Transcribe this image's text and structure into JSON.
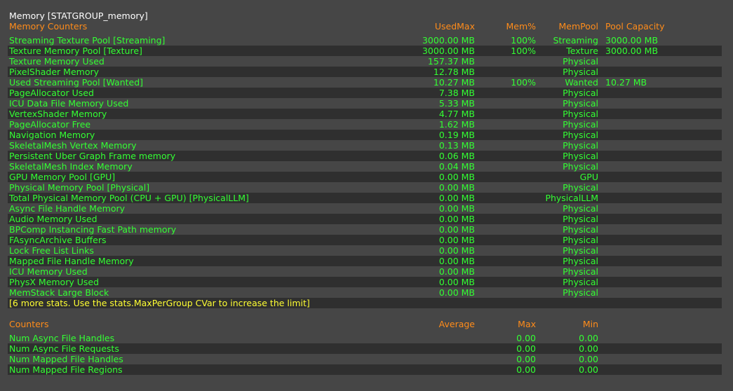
{
  "title": "Memory [STATGROUP_memory]",
  "memory_table": {
    "headers": {
      "name": "Memory Counters",
      "used_max": "UsedMax",
      "mem_pct": "Mem%",
      "mem_pool": "MemPool",
      "pool_capacity": "Pool Capacity"
    },
    "rows": [
      {
        "name": "Streaming Texture Pool [Streaming]",
        "used_max": "3000.00 MB",
        "mem_pct": "100%",
        "mem_pool": "Streaming",
        "pool_capacity": "3000.00 MB"
      },
      {
        "name": "Texture Memory Pool [Texture]",
        "used_max": "3000.00 MB",
        "mem_pct": "100%",
        "mem_pool": "Texture",
        "pool_capacity": "3000.00 MB"
      },
      {
        "name": "Texture Memory Used",
        "used_max": "157.37 MB",
        "mem_pct": "",
        "mem_pool": "Physical",
        "pool_capacity": ""
      },
      {
        "name": "PixelShader Memory",
        "used_max": "12.78 MB",
        "mem_pct": "",
        "mem_pool": "Physical",
        "pool_capacity": ""
      },
      {
        "name": "Used Streaming Pool [Wanted]",
        "used_max": "10.27 MB",
        "mem_pct": "100%",
        "mem_pool": "Wanted",
        "pool_capacity": "10.27 MB"
      },
      {
        "name": "PageAllocator Used",
        "used_max": "7.38 MB",
        "mem_pct": "",
        "mem_pool": "Physical",
        "pool_capacity": ""
      },
      {
        "name": "ICU Data File Memory Used",
        "used_max": "5.33 MB",
        "mem_pct": "",
        "mem_pool": "Physical",
        "pool_capacity": ""
      },
      {
        "name": "VertexShader Memory",
        "used_max": "4.77 MB",
        "mem_pct": "",
        "mem_pool": "Physical",
        "pool_capacity": ""
      },
      {
        "name": "PageAllocator Free",
        "used_max": "1.62 MB",
        "mem_pct": "",
        "mem_pool": "Physical",
        "pool_capacity": ""
      },
      {
        "name": "Navigation Memory",
        "used_max": "0.19 MB",
        "mem_pct": "",
        "mem_pool": "Physical",
        "pool_capacity": ""
      },
      {
        "name": "SkeletalMesh Vertex Memory",
        "used_max": "0.13 MB",
        "mem_pct": "",
        "mem_pool": "Physical",
        "pool_capacity": ""
      },
      {
        "name": "Persistent Uber Graph Frame memory",
        "used_max": "0.06 MB",
        "mem_pct": "",
        "mem_pool": "Physical",
        "pool_capacity": ""
      },
      {
        "name": "SkeletalMesh Index Memory",
        "used_max": "0.04 MB",
        "mem_pct": "",
        "mem_pool": "Physical",
        "pool_capacity": ""
      },
      {
        "name": "GPU Memory Pool [GPU]",
        "used_max": "0.00 MB",
        "mem_pct": "",
        "mem_pool": "GPU",
        "pool_capacity": ""
      },
      {
        "name": "Physical Memory Pool [Physical]",
        "used_max": "0.00 MB",
        "mem_pct": "",
        "mem_pool": "Physical",
        "pool_capacity": ""
      },
      {
        "name": "Total Physical Memory Pool (CPU + GPU) [PhysicalLLM]",
        "used_max": "0.00 MB",
        "mem_pct": "",
        "mem_pool": "PhysicalLLM",
        "pool_capacity": ""
      },
      {
        "name": "Async File Handle Memory",
        "used_max": "0.00 MB",
        "mem_pct": "",
        "mem_pool": "Physical",
        "pool_capacity": ""
      },
      {
        "name": "Audio Memory Used",
        "used_max": "0.00 MB",
        "mem_pct": "",
        "mem_pool": "Physical",
        "pool_capacity": ""
      },
      {
        "name": "BPComp Instancing Fast Path memory",
        "used_max": "0.00 MB",
        "mem_pct": "",
        "mem_pool": "Physical",
        "pool_capacity": ""
      },
      {
        "name": "FAsyncArchive Buffers",
        "used_max": "0.00 MB",
        "mem_pct": "",
        "mem_pool": "Physical",
        "pool_capacity": ""
      },
      {
        "name": "Lock Free List Links",
        "used_max": "0.00 MB",
        "mem_pct": "",
        "mem_pool": "Physical",
        "pool_capacity": ""
      },
      {
        "name": "Mapped File Handle Memory",
        "used_max": "0.00 MB",
        "mem_pct": "",
        "mem_pool": "Physical",
        "pool_capacity": ""
      },
      {
        "name": "ICU Memory Used",
        "used_max": "0.00 MB",
        "mem_pct": "",
        "mem_pool": "Physical",
        "pool_capacity": ""
      },
      {
        "name": "PhysX Memory Used",
        "used_max": "0.00 MB",
        "mem_pct": "",
        "mem_pool": "Physical",
        "pool_capacity": ""
      },
      {
        "name": "MemStack Large Block",
        "used_max": "0.00 MB",
        "mem_pct": "",
        "mem_pool": "Physical",
        "pool_capacity": ""
      }
    ],
    "note": "[6 more stats. Use the stats.MaxPerGroup CVar to increase the limit]"
  },
  "counters_table": {
    "headers": {
      "name": "Counters",
      "average": "Average",
      "max": "Max",
      "min": "Min"
    },
    "rows": [
      {
        "name": "Num Async File Handles",
        "average": "",
        "max": "0.00",
        "min": "0.00"
      },
      {
        "name": "Num Async File Requests",
        "average": "",
        "max": "0.00",
        "min": "0.00"
      },
      {
        "name": "Num Mapped File Handles",
        "average": "",
        "max": "0.00",
        "min": "0.00"
      },
      {
        "name": "Num Mapped File Regions",
        "average": "",
        "max": "0.00",
        "min": "0.00"
      }
    ]
  },
  "colors": {
    "background": "#464646",
    "row_shade": "#2f2f2f",
    "value_text": "#33ff33",
    "header_text": "#ff8c1a",
    "title_text": "#ffffff",
    "note_text": "#ffff33"
  }
}
